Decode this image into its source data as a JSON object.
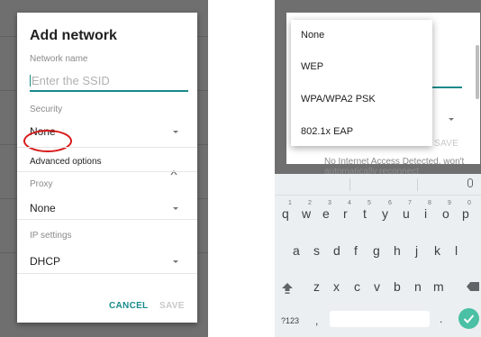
{
  "left_dialog": {
    "title": "Add network",
    "network_name_label": "Network name",
    "ssid_placeholder": "Enter the SSID",
    "security_label": "Security",
    "security_value": "None",
    "advanced_options_label": "Advanced options",
    "proxy_label": "Proxy",
    "proxy_value": "None",
    "ip_settings_label": "IP settings",
    "ip_settings_value": "DHCP",
    "cancel_label": "CANCEL",
    "save_label": "SAVE"
  },
  "right_dialog": {
    "save_label": "SAVE",
    "background_text": "No Internet Access Detected, won't automatically reconnect",
    "security_options": [
      "None",
      "WEP",
      "WPA/WPA2 PSK",
      "802.1x EAP"
    ]
  },
  "keyboard": {
    "row1": [
      "q",
      "w",
      "e",
      "r",
      "t",
      "y",
      "u",
      "i",
      "o",
      "p"
    ],
    "row1_numbers": [
      "1",
      "2",
      "3",
      "4",
      "5",
      "6",
      "7",
      "8",
      "9",
      "0"
    ],
    "row2": [
      "a",
      "s",
      "d",
      "f",
      "g",
      "h",
      "j",
      "k",
      "l"
    ],
    "row3": [
      "z",
      "x",
      "c",
      "v",
      "b",
      "n",
      "m"
    ],
    "symbols_label": "?123",
    "comma": ",",
    "period": "."
  },
  "colors": {
    "accent": "#1a8a8a",
    "annotation_red": "#d81a1a",
    "enter_key": "#4ac0a4",
    "dim_background": "#6f6f6f"
  },
  "icons": [
    "dropdown-caret-icon",
    "chevron-up-icon",
    "mic-icon",
    "shift-icon",
    "backspace-icon",
    "checkmark-icon"
  ]
}
